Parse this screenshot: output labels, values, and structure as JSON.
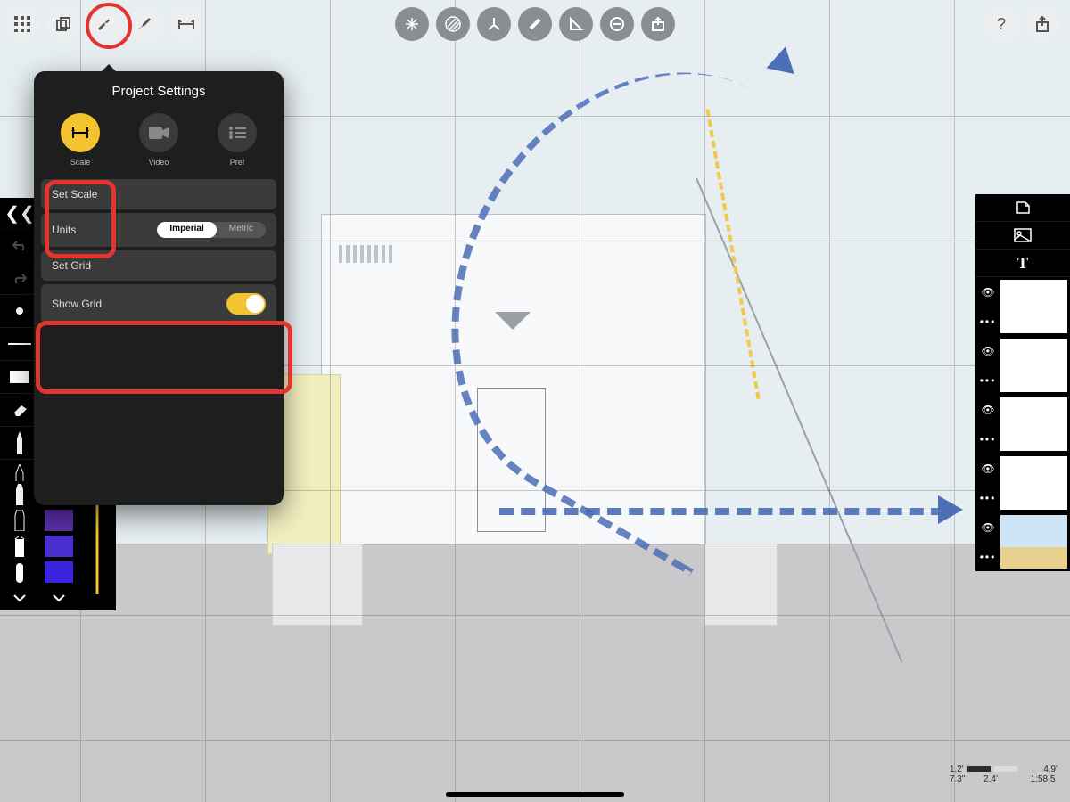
{
  "topbar": {
    "left": [
      "grid-icon",
      "copy-icon",
      "wrench-icon",
      "brush-icon",
      "ruler-icon"
    ],
    "center": [
      "move-3d-icon",
      "hatch-icon",
      "axis-icon",
      "measure-icon",
      "angle-icon",
      "subtract-icon",
      "export-icon"
    ],
    "right": [
      "help-icon",
      "share-icon"
    ]
  },
  "popover": {
    "title": "Project Settings",
    "tabs": [
      {
        "key": "scale",
        "label": "Scale",
        "active": true
      },
      {
        "key": "video",
        "label": "Video",
        "active": false
      },
      {
        "key": "pref",
        "label": "Pref",
        "active": false
      }
    ],
    "rows": {
      "set_scale": "Set Scale",
      "units_label": "Units",
      "units_options": {
        "imperial": "Imperial",
        "metric": "Metric"
      },
      "units_selected": "imperial",
      "set_grid": "Set Grid",
      "show_grid": "Show Grid",
      "show_grid_on": true
    }
  },
  "left_tools": [
    "chevrons-left",
    "undo",
    "redo",
    "dot",
    "line",
    "fill",
    "eraser",
    "pen-fine",
    "pen",
    "marker-tip",
    "marker",
    "highlighter",
    "chevron-down"
  ],
  "swatches": [
    "#7d1b77",
    "#5a2fa8",
    "#4a2fd0",
    "#3a24e0"
  ],
  "right_panel": {
    "top_icons": [
      "page-icon",
      "image-icon",
      "text-icon"
    ],
    "layer_controls": [
      "eye-icon",
      "more-icon"
    ],
    "layer_count": 5
  },
  "scale_readout": {
    "top_left": "1.2'",
    "top_right": "4.9'",
    "bottom_left": "7.3\"",
    "bottom_mid": "2.4'",
    "bottom_right": "1:58.5"
  }
}
